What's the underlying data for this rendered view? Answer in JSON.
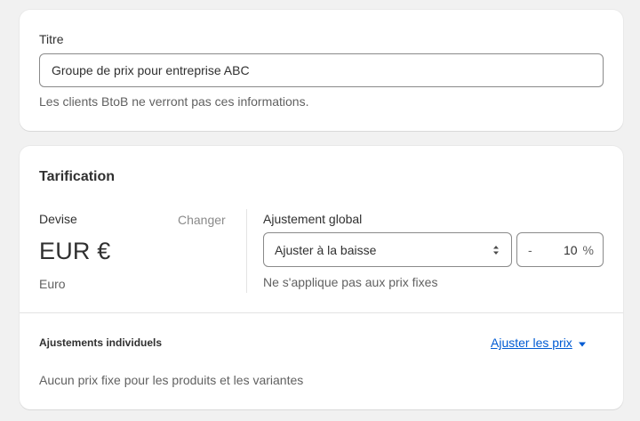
{
  "title_card": {
    "label": "Titre",
    "value": "Groupe de prix pour entreprise ABC",
    "help": "Les clients BtoB ne verront pas ces informations."
  },
  "pricing_card": {
    "heading": "Tarification",
    "currency": {
      "label": "Devise",
      "change_link": "Changer",
      "code": "EUR €",
      "name": "Euro"
    },
    "global_adjustment": {
      "label": "Ajustement global",
      "select_value": "Ajuster à la baisse",
      "sign": "-",
      "percent": "10",
      "unit": "%",
      "help": "Ne s'applique pas aux prix fixes"
    },
    "individual": {
      "heading": "Ajustements individuels",
      "link": "Ajuster les prix",
      "empty_text": "Aucun prix fixe pour les produits et les variantes"
    }
  },
  "colors": {
    "link": "#005bd3",
    "border": "#8a8a8a",
    "muted": "#616161"
  },
  "icons": {
    "select": "select-arrows-icon",
    "dropdown": "caret-down-icon"
  }
}
